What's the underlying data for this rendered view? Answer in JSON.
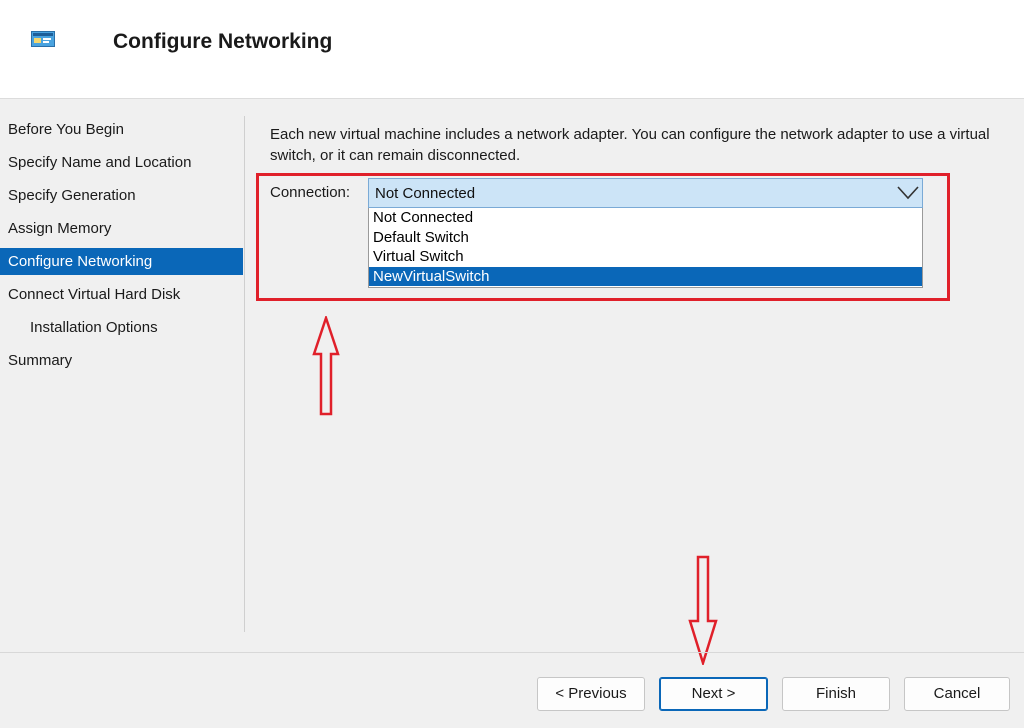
{
  "header": {
    "title": "Configure Networking",
    "icon": "hyperv-window-icon"
  },
  "nav": {
    "items": [
      {
        "label": "Before You Begin"
      },
      {
        "label": "Specify Name and Location"
      },
      {
        "label": "Specify Generation"
      },
      {
        "label": "Assign Memory"
      },
      {
        "label": "Configure Networking",
        "active": true
      },
      {
        "label": "Connect Virtual Hard Disk"
      },
      {
        "label": "Installation Options",
        "indent": true
      },
      {
        "label": "Summary"
      }
    ]
  },
  "main": {
    "description": "Each new virtual machine includes a network adapter. You can configure the network adapter to use a virtual switch, or it can remain disconnected.",
    "connection": {
      "label": "Connection:",
      "selected_value": "Not Connected",
      "options": [
        "Not Connected",
        "Default Switch",
        "Virtual Switch",
        "NewVirtualSwitch"
      ],
      "highlighted_option": "NewVirtualSwitch"
    }
  },
  "buttons": {
    "previous": "< Previous",
    "next": "Next >",
    "finish": "Finish",
    "cancel": "Cancel"
  },
  "colors": {
    "accent": "#0a67b8",
    "annotation": "#e0202a",
    "combo_bg": "#cce4f7"
  }
}
